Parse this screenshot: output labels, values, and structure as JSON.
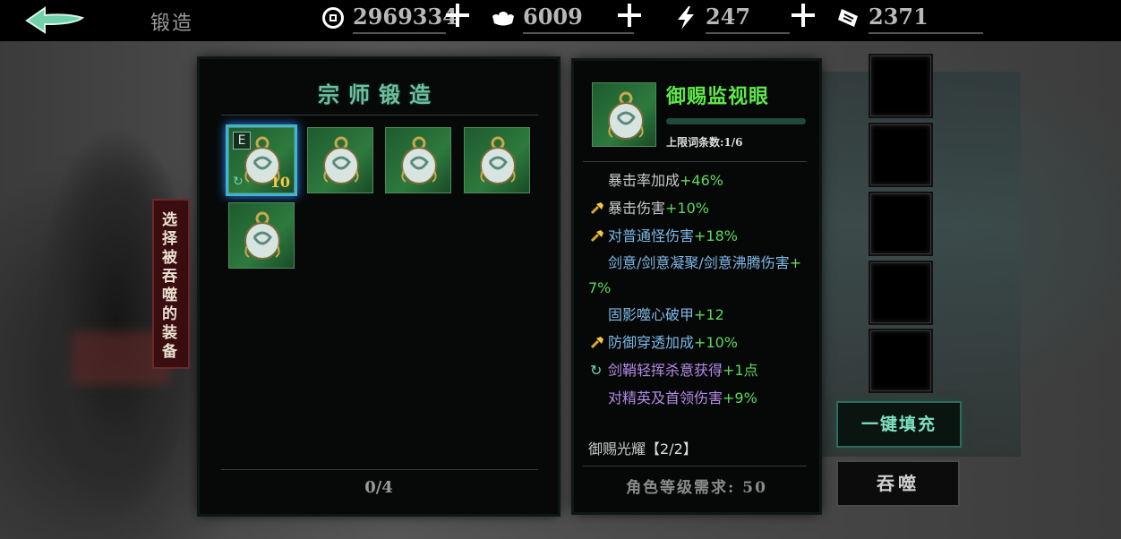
{
  "topbar": {
    "title": "锻造",
    "resources": [
      {
        "icon": "copper-coin-icon",
        "value": "2969334"
      },
      {
        "icon": "silver-ingot-icon",
        "value": "6009"
      },
      {
        "icon": "lightning-stamina-icon",
        "value": "247"
      },
      {
        "icon": "ticket-icon",
        "value": "2371"
      }
    ]
  },
  "forge": {
    "title": "宗师锻造",
    "count": "0/4",
    "items": [
      {
        "selected": true,
        "badge": "E",
        "level": "10"
      },
      {
        "selected": false
      },
      {
        "selected": false
      },
      {
        "selected": false
      },
      {
        "selected": false
      }
    ]
  },
  "side_tab": "选择被吞噬的装备",
  "detail": {
    "name": "御赐监视眼",
    "limit": "上限词条数:1/6",
    "stats": [
      {
        "key": "暴击率加成",
        "value": "+46%",
        "icon": "none",
        "style": "white"
      },
      {
        "key": "暴击伤害",
        "value": "+10%",
        "icon": "hammer-icon",
        "style": "white"
      },
      {
        "key": "对普通怪伤害",
        "value": "+18%",
        "icon": "hammer-icon",
        "style": "blue"
      },
      {
        "key": "剑意/剑意凝聚/剑意沸腾伤害",
        "value": "+",
        "cont": "7%",
        "icon": "none",
        "style": "blue"
      },
      {
        "key": "固影噬心破甲",
        "value": "+12",
        "icon": "none",
        "style": "blue"
      },
      {
        "key": "防御穿透加成",
        "value": "+10%",
        "icon": "hammer-icon",
        "style": "blue"
      },
      {
        "key": "剑鞘轻挥杀意获得",
        "value": "+1点",
        "icon": "cycle-icon",
        "style": "purple"
      },
      {
        "key": "对精英及首领伤害",
        "value": "+9%",
        "icon": "none",
        "style": "purple"
      }
    ],
    "set_name": "御赐光耀",
    "set_count": "【2/2】",
    "requirement": "角色等级需求: 50"
  },
  "buttons": {
    "fill": "一键填充",
    "devour": "吞噬"
  },
  "colors": {
    "accent_green": "#5ee84a",
    "stat_green": "#5dd85a",
    "title_teal": "#6fbf9f",
    "level_gold": "#f3c743"
  }
}
